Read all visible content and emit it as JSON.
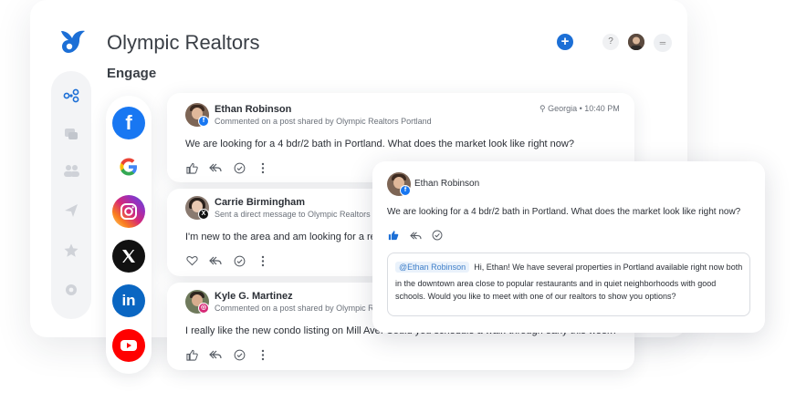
{
  "header": {
    "title": "Olympic Realtors",
    "section": "Engage",
    "help_icon": "?",
    "menu_icon": "═"
  },
  "icons": {
    "logo": "bird-logo-icon",
    "add": "plus-icon",
    "help": "question-icon",
    "menu": "menu-icon"
  },
  "nav": [
    {
      "name": "engage-icon",
      "glyph": "⁘"
    },
    {
      "name": "messages-icon",
      "glyph": "■"
    },
    {
      "name": "people-icon",
      "glyph": "●"
    },
    {
      "name": "send-icon",
      "glyph": "➤"
    },
    {
      "name": "star-icon",
      "glyph": "★"
    },
    {
      "name": "settings-icon",
      "glyph": "⚙"
    }
  ],
  "social": [
    {
      "name": "facebook-icon",
      "glyph": "f",
      "color": "#1877f2"
    },
    {
      "name": "google-icon",
      "glyph": "G",
      "color": "#ffffff"
    },
    {
      "name": "instagram-icon",
      "glyph": "◎",
      "color": "#d62976"
    },
    {
      "name": "x-icon",
      "glyph": "𝕏",
      "color": "#111111"
    },
    {
      "name": "linkedin-icon",
      "glyph": "in",
      "color": "#0a66c2"
    },
    {
      "name": "youtube-icon",
      "glyph": "▶",
      "color": "#ff0000"
    }
  ],
  "posts": [
    {
      "author": "Ethan Robinson",
      "subline": "Commented on a post shared by Olympic Realtors Portland",
      "location": "⚲ Georgia • 10:40 PM",
      "body": "We are looking for a 4 bdr/2 bath in Portland. What does the market look like right now?"
    },
    {
      "author": "Carrie Birmingham",
      "subline": "Sent a direct message to Olympic Realtors Sprin",
      "body": "I'm new to the area and am looking for a realtor. C"
    },
    {
      "author": "Kyle G. Martinez",
      "subline": "Commented on a post shared by Olympic Realto",
      "body": "I really like the new condo listing on Mill Ave. Could you schedule a walk-through early this week?"
    }
  ],
  "reply_card": {
    "author": "Ethan Robinson",
    "body": "We are looking for a 4 bdr/2 bath in Portland. What does the market look like right now?",
    "mention": "@Ethan Robinson",
    "reply_line1": "Hi, Ethan! We have several properties in Portland available right now both",
    "reply_line2": "in the downtown area close to popular restaurants and in quiet neighborhoods with good",
    "reply_line3": "schools. Would you like to meet with one of our realtors to show you options?"
  }
}
